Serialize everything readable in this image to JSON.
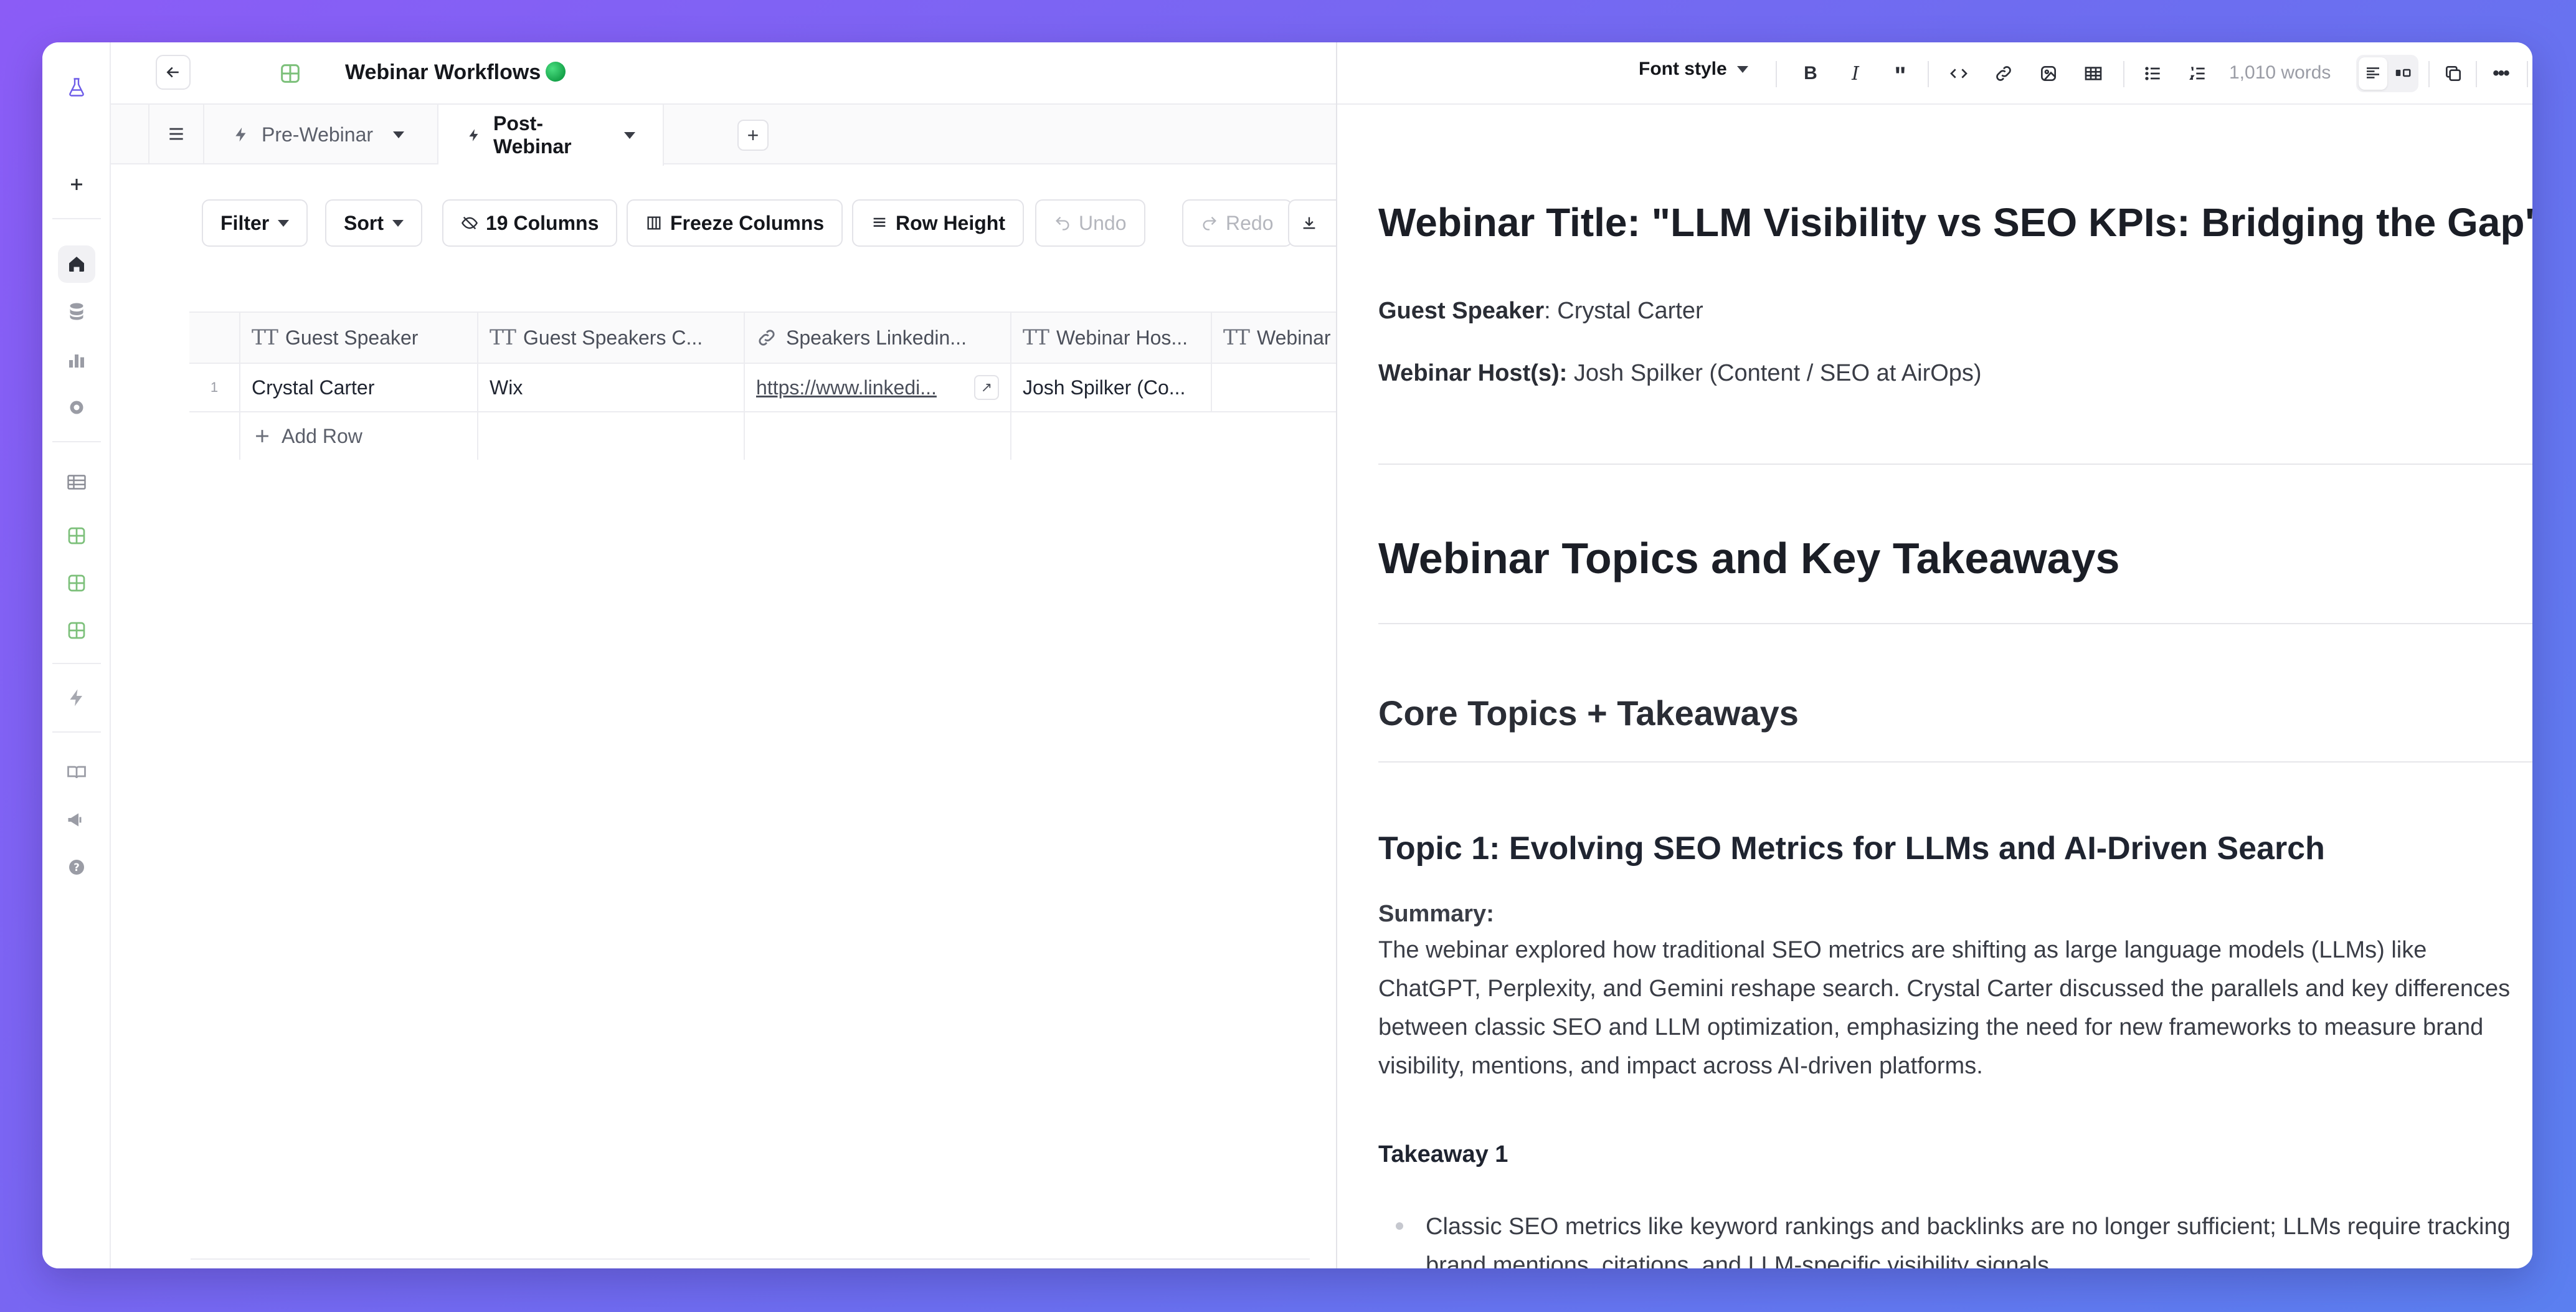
{
  "app": {
    "title": "Webinar Workflows"
  },
  "tabs": [
    {
      "label": "Pre-Webinar"
    },
    {
      "label": "Post-Webinar"
    }
  ],
  "toolbar": {
    "filter": "Filter",
    "sort": "Sort",
    "columns": "19 Columns",
    "freeze": "Freeze Columns",
    "row_height": "Row Height",
    "undo": "Undo",
    "redo": "Redo"
  },
  "table": {
    "columns": [
      "Guest Speaker",
      "Guest Speakers C...",
      "Speakers Linkedin...",
      "Webinar Hos...",
      "Webinar"
    ],
    "rows": [
      {
        "num": "1",
        "cells": [
          "Crystal Carter",
          "Wix",
          "https://www.linkedi...",
          "Josh Spilker (Co...",
          ""
        ]
      }
    ],
    "add_row": "Add Row"
  },
  "doc": {
    "toolbar": {
      "font_style": "Font style",
      "word_count": "1,010 words"
    },
    "title": "Webinar Title: \"LLM Visibility vs SEO KPIs: Bridging the Gap\"",
    "guest_label": "Guest Speaker",
    "guest_value": ": Crystal Carter",
    "host_label": "Webinar Host(s):",
    "host_value": " Josh Spilker (Content / SEO at AirOps)",
    "section_title": "Webinar Topics and Key Takeaways",
    "core_title": "Core Topics + Takeaways",
    "topic1_title": "Topic 1: Evolving SEO Metrics for LLMs and AI-Driven Search",
    "summary_label": "Summary:",
    "summary_lines": [
      "The webinar explored how traditional SEO metrics are shifting as large language models (LLMs) like",
      "ChatGPT, Perplexity, and Gemini reshape search. Crystal Carter discussed the parallels and key differences",
      "between classic SEO and LLM optimization, emphasizing the need for new frameworks to measure brand",
      "visibility, mentions, and impact across AI-driven platforms."
    ],
    "takeaway1_label": "Takeaway 1",
    "takeaway1_lines": [
      "Classic SEO metrics like keyword rankings and backlinks are no longer sufficient; LLMs require tracking",
      "brand mentions, citations, and LLM-specific visibility signals."
    ]
  }
}
